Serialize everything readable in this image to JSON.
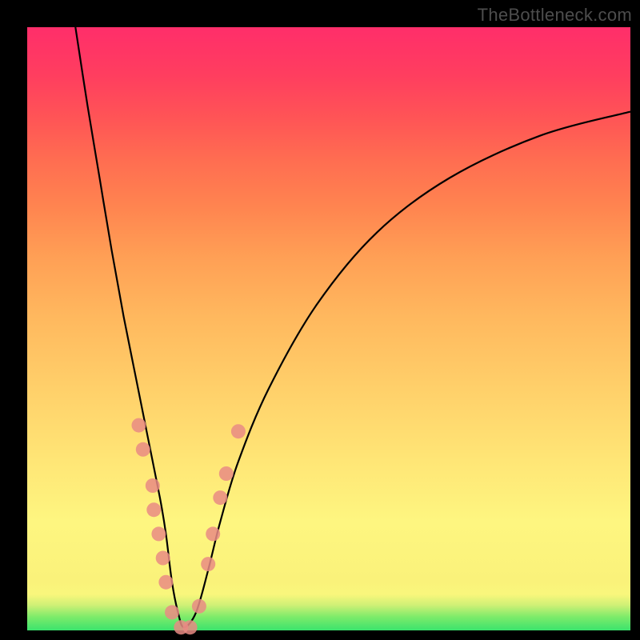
{
  "watermark": "TheBottleneck.com",
  "chart_data": {
    "type": "line",
    "title": "",
    "xlabel": "",
    "ylabel": "",
    "xlim": [
      0,
      100
    ],
    "ylim": [
      0,
      100
    ],
    "series": [
      {
        "name": "bottleneck-curve",
        "x": [
          8,
          10,
          12,
          14,
          16,
          18,
          20,
          22,
          23,
          24,
          25,
          26,
          28,
          30,
          32,
          35,
          40,
          48,
          58,
          70,
          85,
          100
        ],
        "y": [
          100,
          87,
          75,
          63,
          52,
          42,
          32,
          22,
          16,
          8,
          3,
          0.5,
          3,
          10,
          18,
          28,
          40,
          54,
          66,
          75,
          82,
          86
        ]
      }
    ],
    "markers": [
      {
        "x": 18.5,
        "y": 34
      },
      {
        "x": 19.2,
        "y": 30
      },
      {
        "x": 20.8,
        "y": 24
      },
      {
        "x": 21.0,
        "y": 20
      },
      {
        "x": 21.8,
        "y": 16
      },
      {
        "x": 22.5,
        "y": 12
      },
      {
        "x": 23.0,
        "y": 8
      },
      {
        "x": 24.0,
        "y": 3
      },
      {
        "x": 25.5,
        "y": 0.5
      },
      {
        "x": 27.0,
        "y": 0.5
      },
      {
        "x": 28.5,
        "y": 4
      },
      {
        "x": 30.0,
        "y": 11
      },
      {
        "x": 30.8,
        "y": 16
      },
      {
        "x": 32.0,
        "y": 22
      },
      {
        "x": 33.0,
        "y": 26
      },
      {
        "x": 35.0,
        "y": 33
      }
    ],
    "colors": {
      "curve": "#000000",
      "marker_fill": "#e98b84",
      "marker_stroke": "#e98b84",
      "gradient_top": "#ff2e6a",
      "gradient_bottom": "#3be36d"
    }
  }
}
